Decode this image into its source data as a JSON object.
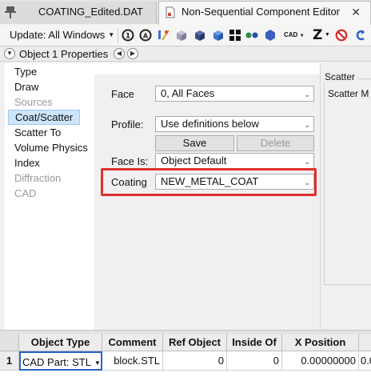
{
  "tabs": [
    {
      "label": "COATING_Edited.DAT",
      "active": false
    },
    {
      "label": "Non-Sequential Component Editor",
      "active": true,
      "close": "✕"
    }
  ],
  "toolbar": {
    "update_label": "Update: All Windows",
    "cad_label": "CAD",
    "z_label": "Z",
    "icons": [
      "refresh-1-icon",
      "refresh-all-icon",
      "lens-wand-icon",
      "shaded-cube-icon",
      "solid-cube-icon",
      "blue-cube-icon",
      "grid-icon",
      "dots-icon",
      "hexagon-icon",
      "cad-icon",
      "z-icon",
      "no-entry-icon",
      "undo-arrow-icon"
    ]
  },
  "properties": {
    "title": "Object 1 Properties"
  },
  "categories": [
    {
      "label": "Type",
      "state": "normal"
    },
    {
      "label": "Draw",
      "state": "normal"
    },
    {
      "label": "Sources",
      "state": "disabled"
    },
    {
      "label": "Coat/Scatter",
      "state": "selected"
    },
    {
      "label": "Scatter To",
      "state": "normal"
    },
    {
      "label": "Volume Physics",
      "state": "normal"
    },
    {
      "label": "Index",
      "state": "normal"
    },
    {
      "label": "Diffraction",
      "state": "disabled"
    },
    {
      "label": "CAD",
      "state": "disabled"
    }
  ],
  "form": {
    "face_label": "Face",
    "face_value": "0, All Faces",
    "profile_label": "Profile:",
    "profile_value": "Use definitions below",
    "save_label": "Save",
    "delete_label": "Delete",
    "face_is_label": "Face Is:",
    "face_is_value": "Object Default",
    "coating_label": "Coating",
    "coating_value": "NEW_METAL_COAT"
  },
  "scatter": {
    "group_label": "Scatter",
    "mode_label": "Scatter M"
  },
  "grid": {
    "headers": [
      "Object Type",
      "Comment",
      "Ref Object",
      "Inside Of",
      "X Position"
    ],
    "rows": [
      {
        "num": "1",
        "type": "CAD Part: STL",
        "comment": "block.STL",
        "ref_object": "0",
        "inside_of": "0",
        "x_position": "0.00000000",
        "next": "0.0"
      }
    ]
  },
  "colors": {
    "highlight": "#e0302d",
    "selection": "#cde5fb"
  }
}
